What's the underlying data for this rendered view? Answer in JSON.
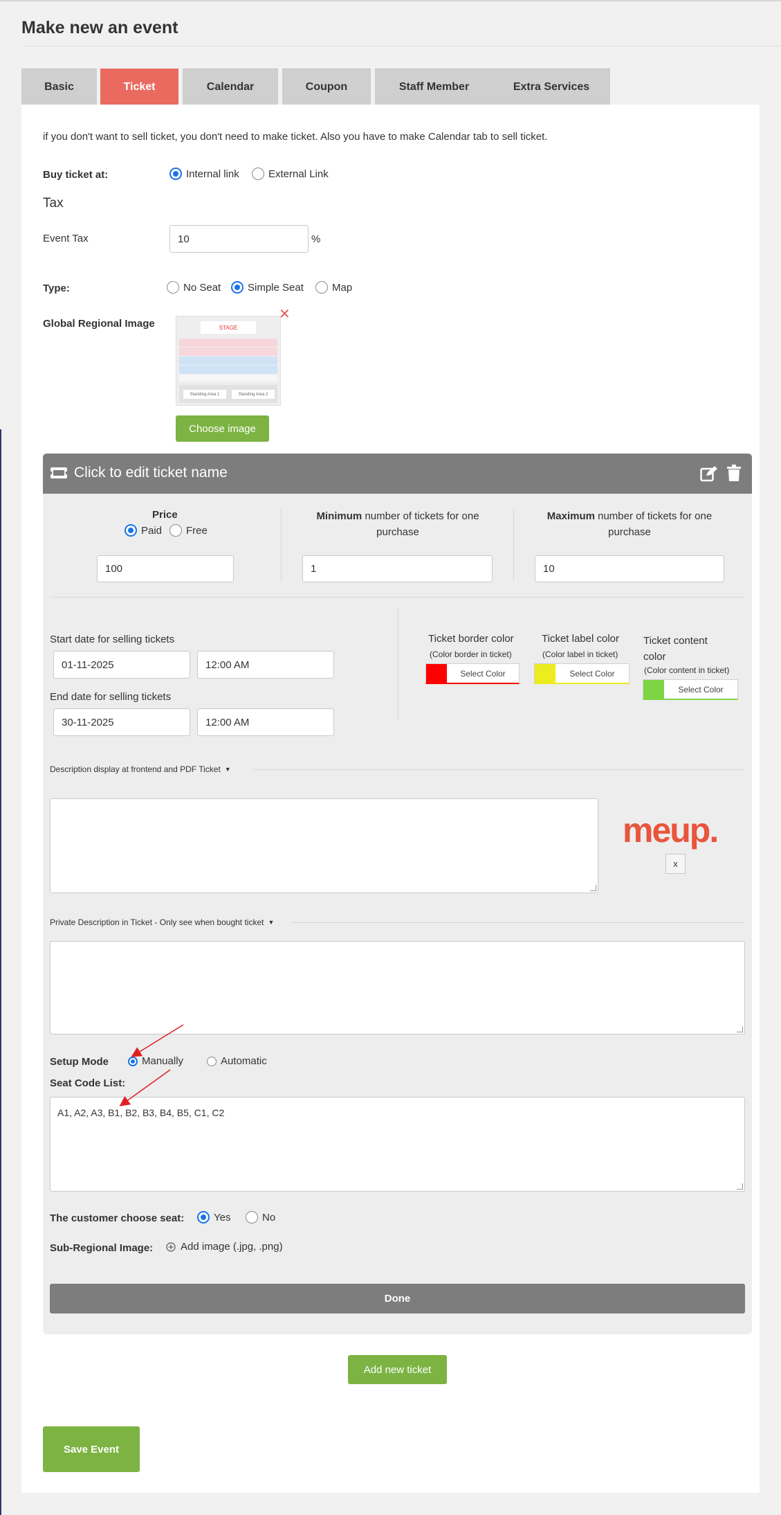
{
  "page": {
    "title": "Make new an event"
  },
  "tabs": [
    "Basic",
    "Ticket",
    "Calendar",
    "Coupon",
    "Staff Member",
    "Extra Services"
  ],
  "active_tab": "Ticket",
  "notice": "if you don't want to sell ticket, you don't need to make ticket. Also you have to make Calendar tab to sell ticket.",
  "buy_ticket": {
    "label": "Buy ticket at:",
    "options": [
      "Internal link",
      "External Link"
    ],
    "selected": "Internal link"
  },
  "tax": {
    "heading": "Tax",
    "label": "Event Tax",
    "value": "10",
    "unit": "%"
  },
  "type": {
    "label": "Type:",
    "options": [
      "No Seat",
      "Simple Seat",
      "Map"
    ],
    "selected": "Simple Seat"
  },
  "regional_image": {
    "label": "Global Regional Image",
    "choose_button": "Choose image",
    "remove_icon": "close-icon",
    "thumb": {
      "stage": "STAGE",
      "area1": "Standing Area 1",
      "area2": "Standing Area 2"
    }
  },
  "ticket": {
    "name_placeholder": "Click to edit ticket name",
    "price": {
      "label": "Price",
      "options": [
        "Paid",
        "Free"
      ],
      "selected": "Paid",
      "value": "100"
    },
    "minimum": {
      "bold": "Minimum",
      "rest": "number of tickets for one purchase",
      "value": "1"
    },
    "maximum": {
      "bold": "Maximum",
      "rest": "number of tickets for one purchase",
      "value": "10"
    },
    "start_label": "Start date for selling tickets",
    "start_date": "01-11-2025",
    "start_time": "12:00 AM",
    "end_label": "End date for selling tickets",
    "end_date": "30-11-2025",
    "end_time": "12:00 AM",
    "colors": [
      {
        "title": "Ticket border color",
        "note": "(Color border in ticket)",
        "button": "Select Color",
        "color": "#ff0000"
      },
      {
        "title": "Ticket label color",
        "note": "(Color label in ticket)",
        "button": "Select Color",
        "color": "#ecec1f"
      },
      {
        "title": "Ticket content color",
        "note": "(Color content in ticket)",
        "button": "Select Color",
        "color": "#7fd444"
      }
    ],
    "description_label": "Description display at frontend and PDF Ticket",
    "logo_text": "meup.",
    "logo_remove": "x",
    "private_description_label": "Private Description in Ticket - Only see when bought ticket",
    "setup_mode": {
      "label": "Setup Mode",
      "options": [
        "Manually",
        "Automatic"
      ],
      "selected": "Manually"
    },
    "seat_code": {
      "label": "Seat Code List:",
      "value": "A1, A2, A3, B1, B2, B3, B4, B5, C1, C2"
    },
    "customer_choose": {
      "label": "The customer choose seat:",
      "options": [
        "Yes",
        "No"
      ],
      "selected": "Yes"
    },
    "sub_regional": {
      "label": "Sub-Regional Image:",
      "add_text": "Add image (.jpg, .png)"
    },
    "done_button": "Done"
  },
  "add_ticket_button": "Add new ticket",
  "save_button": "Save Event",
  "colors": {
    "accent": "#ea6a60",
    "green": "#7cb342",
    "radio": "#1a73e8",
    "ticket_header": "#7d7d7d"
  }
}
